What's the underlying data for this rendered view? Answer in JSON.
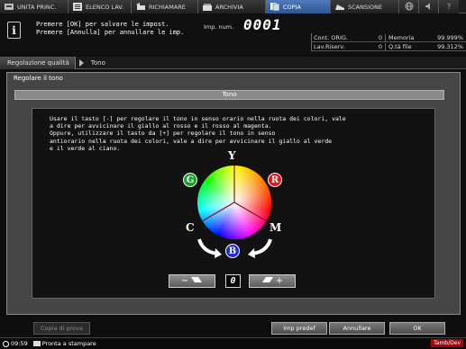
{
  "tabs": [
    {
      "label": "UNITA PRINC.",
      "icon": "machine-icon",
      "active": false
    },
    {
      "label": "ELENCO LAV.",
      "icon": "job-list-icon",
      "active": false
    },
    {
      "label": "RICHIAMARE",
      "icon": "recall-icon",
      "active": false
    },
    {
      "label": "ARCHIVIA",
      "icon": "archive-icon",
      "active": false
    },
    {
      "label": "COPIA",
      "icon": "copy-icon",
      "active": true
    },
    {
      "label": "SCANSIONE",
      "icon": "scan-icon",
      "active": false
    }
  ],
  "message": {
    "line1": "Premere [OK] per salvare le impost.",
    "line2": "Premere [Annulla] per annullare le imp."
  },
  "impression": {
    "label": "Imp. num.",
    "value": "0001"
  },
  "status": {
    "cont_orig_label": "Cont. ORIG.",
    "cont_orig_value": "0",
    "memoria_label": "Memoria",
    "memoria_value": "99.999%",
    "lav_riserv_label": "Lav.Riserv.",
    "lav_riserv_value": "0",
    "qta_file_label": "Q.tà file",
    "qta_file_value": "99.312%"
  },
  "breadcrumb": {
    "parent": "Regolazione qualità",
    "current": "Tono"
  },
  "panel": {
    "title": "Regolare il tono",
    "section_title": "Tono",
    "instructions": "Usare il tasto [-] per regolare il tono in senso orario nella ruota dei colori, vale\na dire per avvicinare il giallo al rosso e il rosso al magenta.\nOppure, utilizzare il tasto da [+] per regolare il tono in senso\nantiorario nella ruota dei colori, vale a dire per avvicinare il giallo al verde\ne il verde al ciano."
  },
  "wheel": {
    "Y": "Y",
    "R": "R",
    "G": "G",
    "C": "C",
    "M": "M",
    "B": "B"
  },
  "adjust": {
    "minus": "−",
    "plus": "+",
    "value": "0"
  },
  "footer": {
    "proof": "Copia di prova",
    "default": "Imp predef",
    "cancel": "Annullare",
    "ok": "OK"
  },
  "statusbar": {
    "time": "09:59",
    "status": "Pronta a stampare",
    "badge": "Tamb/Dev"
  },
  "colors": {
    "active_tab": "#3d68a8",
    "badge_red": "#e8141c",
    "badge_green": "#1aa32a",
    "badge_blue": "#1f2fd1"
  }
}
